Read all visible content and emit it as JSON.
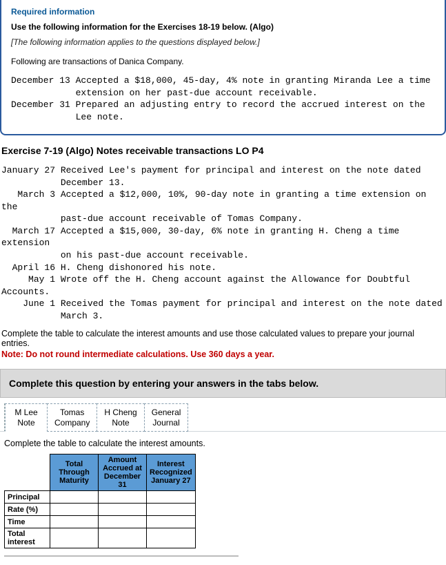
{
  "info": {
    "required": "Required information",
    "useLine": "Use the following information for the Exercises 18-19 below. (Algo)",
    "applies": "[The following information applies to the questions displayed below.]",
    "following": "Following are transactions of Danica Company.",
    "transactions": "December 13 Accepted a $18,000, 45-day, 4% note in granting Miranda Lee a time\n            extension on her past-due account receivable.\nDecember 31 Prepared an adjusting entry to record the accrued interest on the\n            Lee note."
  },
  "exercise": {
    "title": "Exercise 7-19 (Algo) Notes receivable transactions LO P4",
    "body": "January 27 Received Lee's payment for principal and interest on the note dated\n           December 13.\n   March 3 Accepted a $12,000, 10%, 90-day note in granting a time extension on the\n           past-due account receivable of Tomas Company.\n  March 17 Accepted a $15,000, 30-day, 6% note in granting H. Cheng a time extension\n           on his past-due account receivable.\n  April 16 H. Cheng dishonored his note.\n     May 1 Wrote off the H. Cheng account against the Allowance for Doubtful Accounts.\n    June 1 Received the Tomas payment for principal and interest on the note dated\n           March 3.",
    "complete": "Complete the table to calculate the interest amounts and use those calculated values to prepare your journal entries.",
    "note": "Note: Do not round intermediate calculations. Use 360 days a year."
  },
  "tabs": {
    "banner": "Complete this question by entering your answers in the tabs below.",
    "items": [
      {
        "line1": "M Lee",
        "line2": "Note"
      },
      {
        "line1": "Tomas",
        "line2": "Company"
      },
      {
        "line1": "H Cheng",
        "line2": "Note"
      },
      {
        "line1": "General",
        "line2": "Journal"
      }
    ],
    "instruction": "Complete the table to calculate the interest amounts."
  },
  "table": {
    "headers": {
      "col1": "Total Through Maturity",
      "col2": "Amount Accrued at December 31",
      "col3": "Interest Recognized January 27"
    },
    "rows": {
      "r1": "Principal",
      "r2": "Rate (%)",
      "r3": "Time",
      "r4": "Total interest"
    }
  }
}
